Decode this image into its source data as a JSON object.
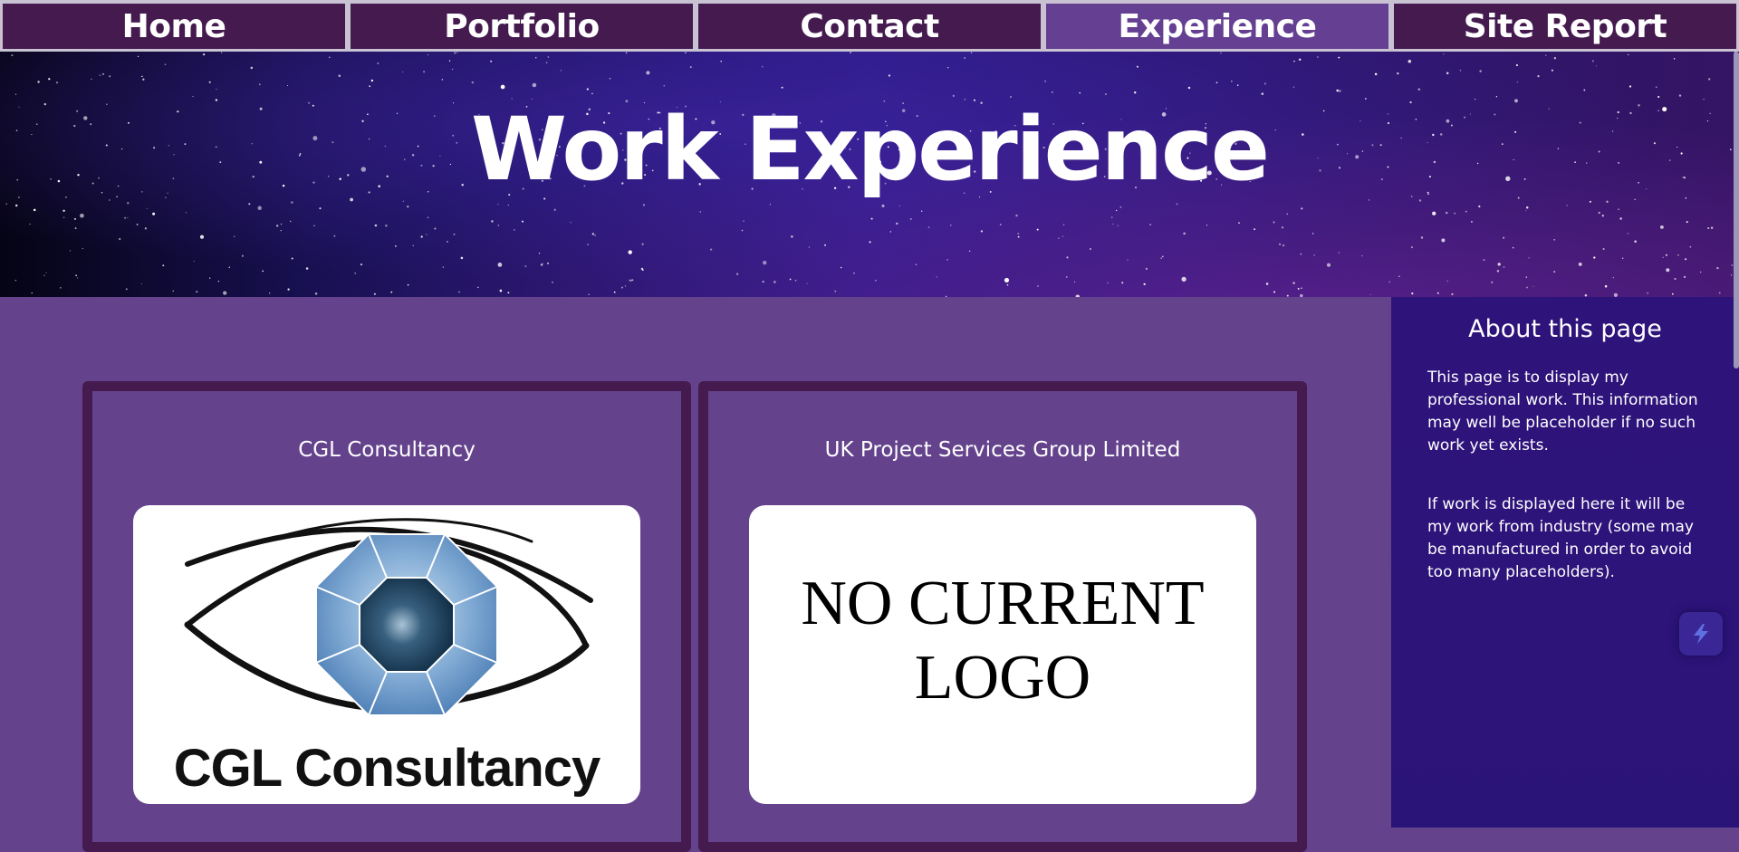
{
  "nav": {
    "items": [
      {
        "label": "Home",
        "active": false
      },
      {
        "label": "Portfolio",
        "active": false
      },
      {
        "label": "Contact",
        "active": false
      },
      {
        "label": "Experience",
        "active": true
      },
      {
        "label": "Site Report",
        "active": false
      }
    ]
  },
  "hero": {
    "title": "Work Experience"
  },
  "cards": [
    {
      "title": "CGL Consultancy",
      "logo_text": "CGL Consultancy"
    },
    {
      "title": "UK Project Services Group Limited",
      "logo_text_line1": "NO CURRENT",
      "logo_text_line2": "LOGO"
    }
  ],
  "sidebar": {
    "title": "About this page",
    "paragraph1": "This page is to display my professional work. This information may well be placeholder if no such work yet exists.",
    "paragraph2": "If work is displayed here it will be my work from industry (some may be manufactured in order to avoid too many placeholders)."
  },
  "colors": {
    "nav_bg": "#441a4f",
    "nav_active": "#643f92",
    "main_bg": "#64438c",
    "sidebar_bg": "#2e137b",
    "card_border": "#441a4f"
  },
  "icons": {
    "floating_button": "lightning-icon"
  }
}
